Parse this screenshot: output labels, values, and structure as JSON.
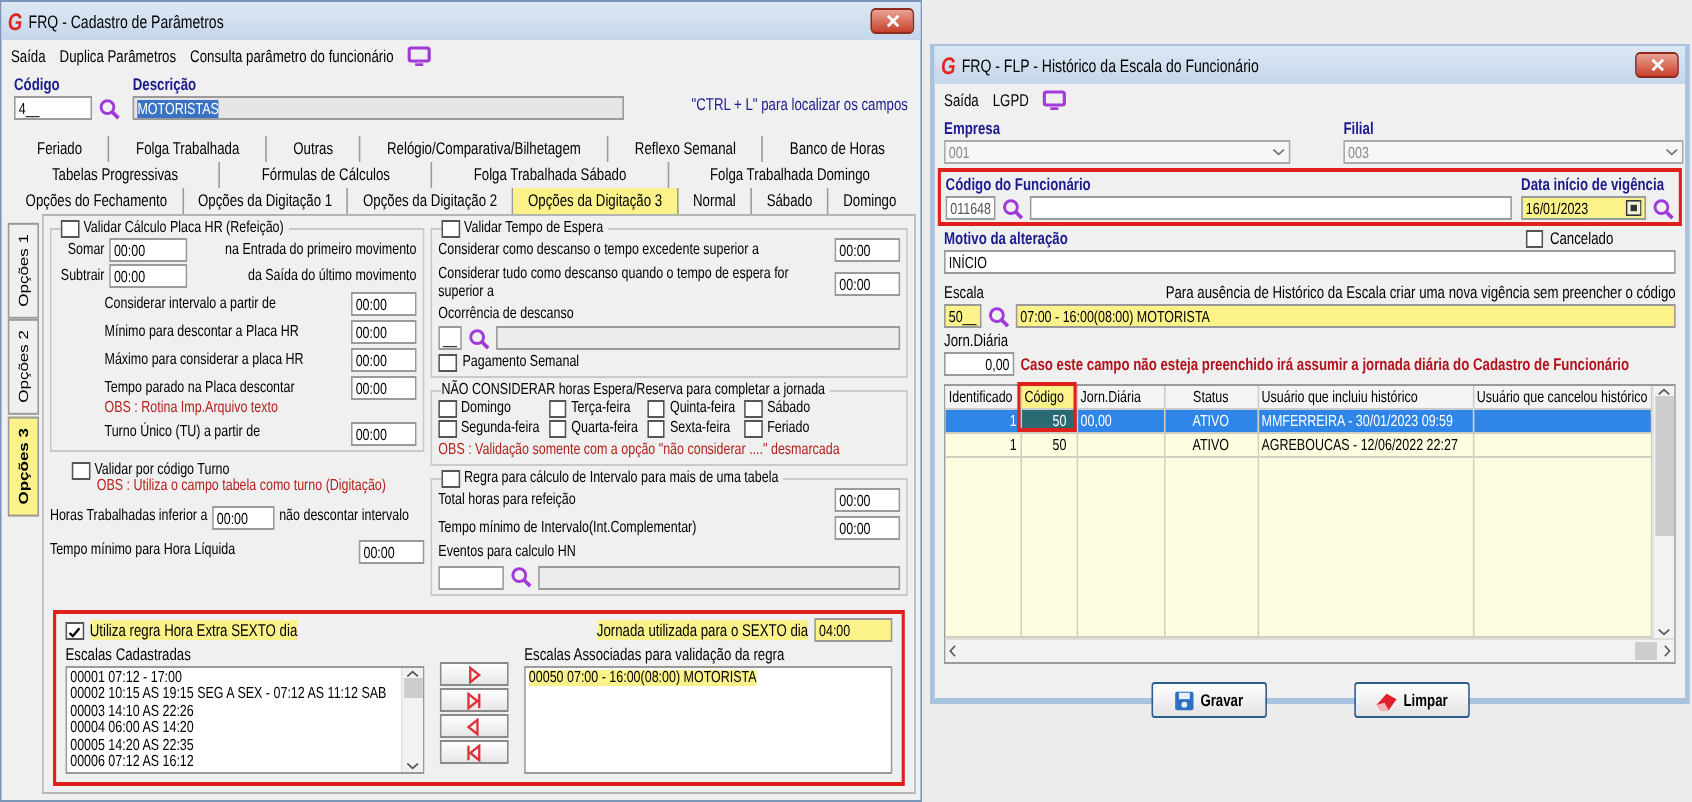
{
  "left_window": {
    "logo": "G",
    "title": "FRQ - Cadastro de Parâmetros",
    "menu": [
      "Saída",
      "Duplica Parâmetros",
      "Consulta parâmetro do funcionário"
    ],
    "codigo": {
      "label": "Código",
      "value": "4__"
    },
    "descricao": {
      "label": "Descrição",
      "value": "MOTORISTAS"
    },
    "hint": "\"CTRL + L\" para localizar os campos",
    "tab_rows": [
      [
        {
          "label": "Feriado",
          "selected": false
        },
        {
          "label": "Folga Trabalhada",
          "selected": false
        },
        {
          "label": "Outras",
          "selected": false
        },
        {
          "label": "Relógio/Comparativa/Bilhetagem",
          "selected": false
        },
        {
          "label": "Reflexo Semanal",
          "selected": false
        },
        {
          "label": "Banco de Horas",
          "selected": false
        }
      ],
      [
        {
          "label": "Tabelas Progressivas",
          "selected": false
        },
        {
          "label": "Fórmulas de Cálculos",
          "selected": false
        },
        {
          "label": "Folga Trabalhada Sábado",
          "selected": false
        },
        {
          "label": "Folga Trabalhada Domingo",
          "selected": false
        }
      ],
      [
        {
          "label": "Opções do Fechamento",
          "selected": false
        },
        {
          "label": "Opções da Digitação 1",
          "selected": false
        },
        {
          "label": "Opções da Digitação 2",
          "selected": false
        },
        {
          "label": "Opções da Digitação 3",
          "selected": true
        },
        {
          "label": "Normal",
          "selected": false
        },
        {
          "label": "Sábado",
          "selected": false
        },
        {
          "label": "Domingo",
          "selected": false
        }
      ]
    ],
    "side_tabs": [
      {
        "label": "Opções 1",
        "selected": false
      },
      {
        "label": "Opções 2",
        "selected": false
      },
      {
        "label": "Opções 3",
        "selected": true
      }
    ],
    "placa_hr": {
      "label": "Validar Cálculo Placa HR (Refeição)",
      "checked": false,
      "adjust": [
        {
          "label": "Somar",
          "value": "00:00",
          "note": "na Entrada do primeiro movimento"
        },
        {
          "label": "Subtrair",
          "value": "00:00",
          "note": "da Saída do último movimento"
        }
      ],
      "fields": [
        {
          "label": "Considerar intervalo a partir de",
          "value": "00:00"
        },
        {
          "label": "Mínimo para descontar a Placa HR",
          "value": "00:00"
        },
        {
          "label": "Máximo para considerar a placa HR",
          "value": "00:00"
        },
        {
          "label": "Tempo parado na Placa descontar",
          "value": "00:00",
          "obs": "OBS : Rotina Imp.Arquivo texto"
        },
        {
          "label": "Turno Único (TU) a partir de",
          "value": "00:00"
        }
      ]
    },
    "validar_turno": {
      "label": "Validar por código Turno",
      "checked": false,
      "obs": "OBS : Utiliza o campo tabela como turno (Digitação)"
    },
    "horas_trabalhadas": {
      "label": "Horas Trabalhadas inferior a",
      "value": "00:00",
      "suffix": "não descontar intervalo"
    },
    "tempo_minimo": {
      "label": "Tempo mínimo para Hora Líquida",
      "value": "00:00"
    },
    "tempo_espera": {
      "label": "Validar Tempo de Espera",
      "checked": false,
      "fields": [
        {
          "label": "Considerar como descanso o tempo excedente superior a",
          "value": "00:00"
        },
        {
          "label": "Considerar tudo como descanso quando o tempo de espera for superior a",
          "value": "00:00"
        }
      ],
      "ocorrencia_label": "Ocorrência de descanso",
      "ocorrencia_code": "__",
      "pagamento": {
        "label": "Pagamento Semanal",
        "checked": false
      }
    },
    "nao_considerar": {
      "title": "NÃO CONSIDERAR horas Espera/Reserva  para completar a jornada",
      "days": [
        {
          "label": "Domingo",
          "checked": false
        },
        {
          "label": "Terça-feira",
          "checked": false
        },
        {
          "label": "Quinta-feira",
          "checked": false
        },
        {
          "label": "Sábado",
          "checked": false
        },
        {
          "label": "Segunda-feira",
          "checked": false
        },
        {
          "label": "Quarta-feira",
          "checked": false
        },
        {
          "label": "Sexta-feira",
          "checked": false
        },
        {
          "label": "Feriado",
          "checked": false
        }
      ],
      "obs": "OBS : Validação somente com a opção \"não considerar ....\" desmarcada"
    },
    "intervalo": {
      "label": "Regra para cálculo de Intervalo para mais de uma tabela",
      "checked": false,
      "fields": [
        {
          "label": "Total horas para refeição",
          "value": "00:00"
        },
        {
          "label": "Tempo mínimo de Intervalo(Int.Complementar)",
          "value": "00:00"
        }
      ],
      "eventos_label": "Eventos para calculo HN"
    },
    "sexto_dia": {
      "label": "Utiliza regra Hora Extra SEXTO dia",
      "checked": true,
      "jornada_label": "Jornada utilizada para o SEXTO dia",
      "jornada_value": "04:00",
      "cadastradas_label": "Escalas Cadastradas",
      "cadastradas": [
        "00001 07:12 - 17:00",
        "00002 10:15 AS 19:15 SEG A SEX - 07:12 AS 11:12 SAB",
        "00003 14:10 AS 22:26",
        "00004 06:00 AS 14:20",
        "00005 14:20 AS 22:35",
        "00006 07:12 AS 16:12"
      ],
      "associadas_label": "Escalas Associadas para validação da regra",
      "associadas": [
        "00050 07:00 - 16:00(08:00) MOTORISTA"
      ]
    }
  },
  "right_window": {
    "logo": "G",
    "title": "FRQ - FLP - Histórico da Escala do Funcionário",
    "menu": [
      "Saída",
      "LGPD"
    ],
    "empresa": {
      "label": "Empresa",
      "value": "001"
    },
    "filial": {
      "label": "Filial",
      "value": "003"
    },
    "codigo_funcionario": {
      "label": "Código do Funcionário",
      "value": "011648"
    },
    "data_inicio": {
      "label": "Data início de vigência",
      "value": "16/01/2023"
    },
    "cancelado": {
      "label": "Cancelado",
      "checked": false
    },
    "motivo": {
      "label": "Motivo da alteração",
      "value": "INÍCIO"
    },
    "escala": {
      "label": "Escala",
      "code": "50__",
      "description": "07:00 - 16:00(08:00) MOTORISTA",
      "hint": "Para ausência de Histórico da Escala criar uma nova vigência sem preencher o código"
    },
    "jornada": {
      "label": "Jorn.Diária",
      "value": "0,00",
      "warning": "Caso este campo não esteja preenchido irá assumir a jornada diária do Cadastro de Funcionário"
    },
    "table": {
      "columns": [
        "Identificado",
        "Código",
        "Jorn.Diária",
        "Status",
        "Usuário que incluiu histórico",
        "Usuário que cancelou histórico"
      ],
      "rows": [
        {
          "cells": [
            "1",
            "50",
            "00,00",
            "ATIVO",
            "MMFERREIRA - 30/01/2023 09:59"
          ],
          "selected": true
        },
        {
          "cells": [
            "1",
            "50",
            "",
            "ATIVO",
            "AGREBOUCAS - 12/06/2022 22:27"
          ],
          "selected": false
        }
      ]
    },
    "buttons": [
      {
        "kind": "save",
        "label": "Gravar"
      },
      {
        "kind": "clear",
        "label": "Limpar"
      }
    ]
  }
}
